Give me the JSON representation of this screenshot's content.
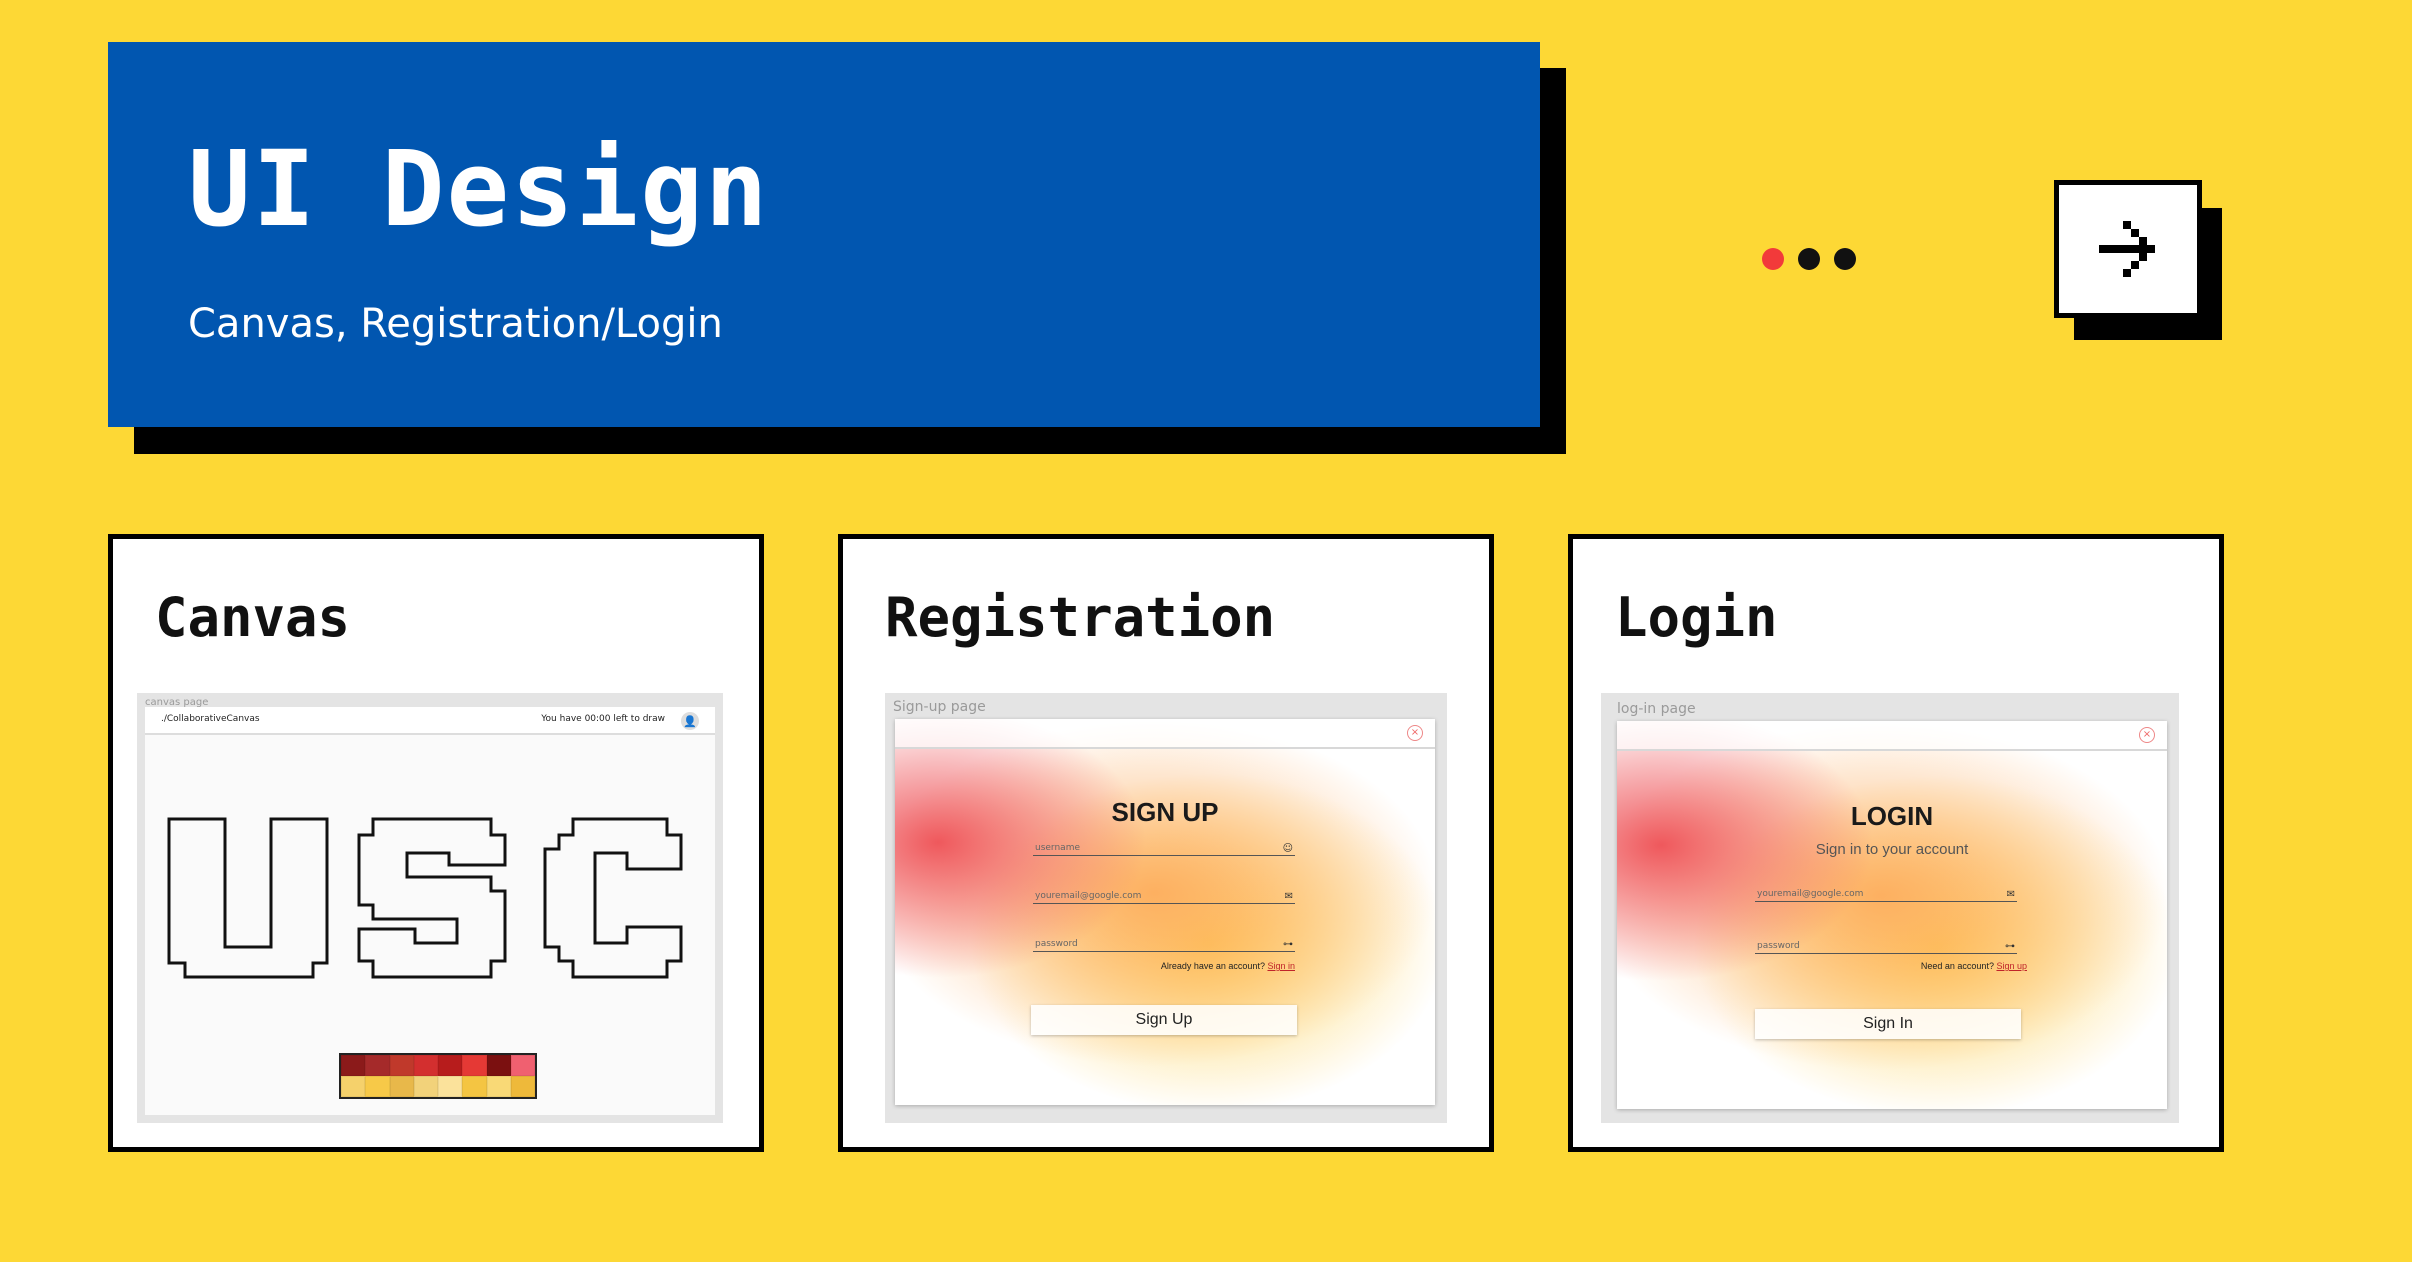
{
  "header": {
    "title": "UI Design",
    "subtitle": "Canvas, Registration/Login"
  },
  "pager": {
    "dots": [
      "active",
      "inactive",
      "inactive"
    ]
  },
  "next_button": {
    "icon": "arrow-right-icon"
  },
  "cards": {
    "canvas": {
      "title": "Canvas",
      "shot_label": "canvas page",
      "path": "./CollaborativeCanvas",
      "timer_text": "You have 00:00 left to draw",
      "art_text": "USC",
      "palette_top": [
        "#8B1A1A",
        "#A52A2A",
        "#C0392B",
        "#D32F2F",
        "#B71C1C",
        "#E53935",
        "#7B1010",
        "#F06070"
      ],
      "palette_bottom": [
        "#F5D16B",
        "#F7C948",
        "#E8B84A",
        "#F2D27A",
        "#FBE29B",
        "#F4C542",
        "#F9D976",
        "#EEB93A"
      ]
    },
    "registration": {
      "title": "Registration",
      "shot_label": "Sign-up page",
      "heading": "SIGN UP",
      "username_placeholder": "username",
      "email_placeholder": "youremail@google.com",
      "password_placeholder": "password",
      "alt_text": "Already have an account?",
      "alt_link": "Sign in",
      "button": "Sign Up"
    },
    "login": {
      "title": "Login",
      "shot_label": "log-in page",
      "heading": "LOGIN",
      "subheading": "Sign in to your account",
      "email_placeholder": "youremail@google.com",
      "password_placeholder": "password",
      "alt_text": "Need an account?",
      "alt_link": "Sign up",
      "button": "Sign In"
    }
  }
}
